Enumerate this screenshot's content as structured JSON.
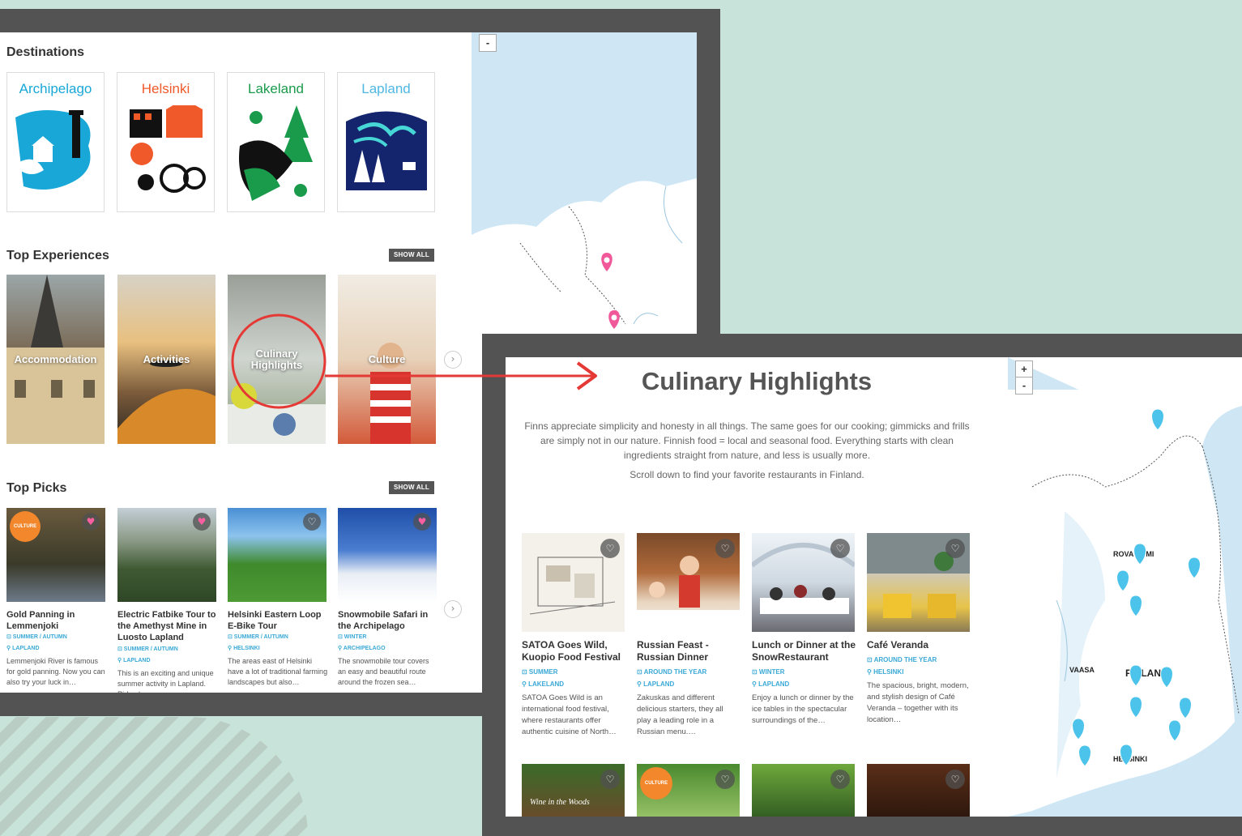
{
  "screen1": {
    "zoom_out": "-",
    "destinations": {
      "heading": "Destinations",
      "cards": [
        {
          "name": "Archipelago",
          "color": "#19a7d8"
        },
        {
          "name": "Helsinki",
          "color": "#f0592a"
        },
        {
          "name": "Lakeland",
          "color": "#1a9b4c"
        },
        {
          "name": "Lapland",
          "color": "#4fb7e3"
        }
      ]
    },
    "top_experiences": {
      "heading": "Top Experiences",
      "show_all": "SHOW ALL",
      "next": "›",
      "cards": [
        {
          "label": "Accommodation"
        },
        {
          "label": "Activities"
        },
        {
          "label": "Culinary Highlights"
        },
        {
          "label": "Culture"
        }
      ]
    },
    "top_picks": {
      "heading": "Top Picks",
      "show_all": "SHOW ALL",
      "next": "›",
      "items": [
        {
          "title": "Gold Panning in Lemmenjoki",
          "season": "⊡ SUMMER / AUTUMN",
          "region": "⚲ LAPLAND",
          "desc": "Lemmenjoki River is famous for gold panning. Now you can also try your luck in…",
          "badge": "CULTURE",
          "favorited": true
        },
        {
          "title": "Electric Fatbike Tour to the Amethyst Mine in Luosto Lapland",
          "season": "⊡ SUMMER / AUTUMN",
          "region": "⚲ LAPLAND",
          "desc": "This is an exciting and unique summer activity in Lapland. Ride along…",
          "favorited": true
        },
        {
          "title": "Helsinki Eastern Loop E-Bike Tour",
          "season": "⊡ SUMMER / AUTUMN",
          "region": "⚲ HELSINKI",
          "desc": "The areas east of Helsinki have a lot of traditional farming landscapes but also…",
          "favorited": false
        },
        {
          "title": "Snowmobile Safari in the Archipelago",
          "season": "⊡ WINTER",
          "region": "⚲ ARCHIPELAGO",
          "desc": "The snowmobile tour covers an easy and beautiful route around the frozen sea…",
          "favorited": true
        }
      ]
    }
  },
  "screen2": {
    "zoom_in": "+",
    "zoom_out": "-",
    "title": "Culinary Highlights",
    "intro": "Finns appreciate simplicity and honesty in all things. The same goes for our cooking; gimmicks and frills are simply not in our nature. Finnish food = local and seasonal food. Everything starts with clean ingredients straight from nature, and less is usually more.",
    "scroll_hint": "Scroll down to find your favorite restaurants in Finland.",
    "restaurants": [
      {
        "title": "SATOA Goes Wild, Kuopio Food Festival",
        "season": "⊡ SUMMER",
        "region": "⚲ LAKELAND",
        "desc": "SATOA Goes Wild is an international food festival, where restaurants offer authentic cuisine of North…"
      },
      {
        "title": "Russian Feast - Russian Dinner",
        "season": "⊡ AROUND THE YEAR",
        "region": "⚲ LAPLAND",
        "desc": "Zakuskas and different delicious starters, they all play a leading role in a Russian menu.…"
      },
      {
        "title": "Lunch or Dinner at the SnowRestaurant",
        "season": "⊡ WINTER",
        "region": "⚲ LAPLAND",
        "desc": "Enjoy a lunch or dinner by the ice tables in the spectacular surroundings of the…"
      },
      {
        "title": "Café Veranda",
        "season": "⊡ AROUND THE YEAR",
        "region": "⚲ HELSINKI",
        "desc": "The spacious, bright, modern, and stylish design of Café Veranda – together with its location…"
      }
    ],
    "row2_badge": "CULTURE",
    "row2_sign": "Wine in the Woods",
    "map_labels": {
      "rovaniemi": "ROVANIEMI",
      "vaasa": "VAASA",
      "finland": "FINLAND",
      "helsinki": "HELSINKI"
    }
  },
  "colors": {
    "pin_pink": "#f0589a",
    "pin_blue": "#4cc3ea",
    "accent_link": "#3aa9d6",
    "arrow_red": "#e53935"
  }
}
